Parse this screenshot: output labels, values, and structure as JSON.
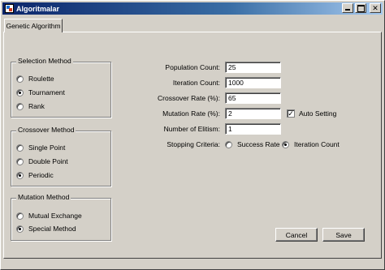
{
  "window": {
    "title": "Algoritmalar"
  },
  "tabs": [
    {
      "label": "Genetic Algorithm"
    }
  ],
  "selection": {
    "title": "Selection Method",
    "options": [
      "Roulette",
      "Tournament",
      "Rank"
    ],
    "selected": "Tournament"
  },
  "crossover": {
    "title": "Crossover Method",
    "options": [
      "Single Point",
      "Double Point",
      "Periodic"
    ],
    "selected": "Periodic"
  },
  "mutation": {
    "title": "Mutation Method",
    "options": [
      "Mutual Exchange",
      "Special Method"
    ],
    "selected": "Special Method"
  },
  "params": {
    "population_label": "Population Count:",
    "population_value": "25",
    "iteration_label": "Iteration Count:",
    "iteration_value": "1000",
    "crossover_label": "Crossover Rate (%):",
    "crossover_value": "65",
    "mutation_label": "Mutation Rate (%):",
    "mutation_value": "2",
    "elitism_label": "Number of Elitism:",
    "elitism_value": "1",
    "auto_setting_label": "Auto Setting",
    "auto_setting_checked": true,
    "stopping_label": "Stopping Criteria:",
    "stopping_options": [
      "Success Rate",
      "Iteration Count"
    ],
    "stopping_selected": "Iteration Count"
  },
  "buttons": {
    "cancel": "Cancel",
    "save": "Save"
  }
}
